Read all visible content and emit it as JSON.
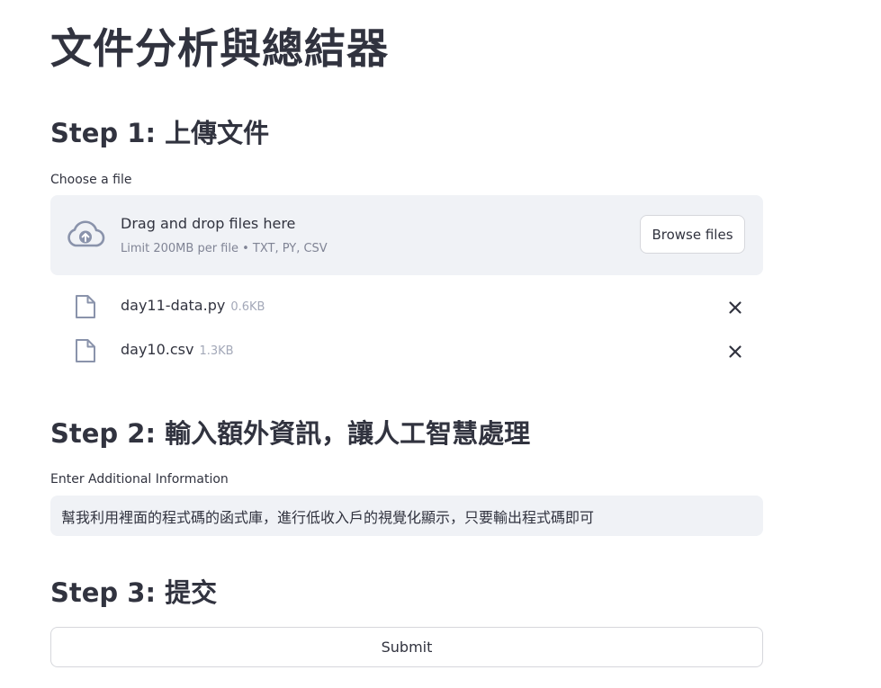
{
  "app": {
    "title": "文件分析與總結器"
  },
  "step1": {
    "heading": "Step 1: 上傳文件",
    "uploader_label": "Choose a file",
    "dropzone": {
      "icon": "cloud-upload-icon",
      "main_text": "Drag and drop files here",
      "sub_text": "Limit 200MB per file • TXT, PY, CSV",
      "browse_label": "Browse files"
    },
    "files": [
      {
        "name": "day11-data.py",
        "size": "0.6KB",
        "icon": "file-icon",
        "remove_icon": "close-icon"
      },
      {
        "name": "day10.csv",
        "size": "1.3KB",
        "icon": "file-icon",
        "remove_icon": "close-icon"
      }
    ]
  },
  "step2": {
    "heading": "Step 2: 輸入額外資訊，讓人工智慧處理",
    "input_label": "Enter Additional Information",
    "input_value": "幫我利用裡面的程式碼的函式庫，進行低收入戶的視覺化顯示，只要輸出程式碼即可"
  },
  "step3": {
    "heading": "Step 3: 提交",
    "submit_label": "Submit"
  },
  "colors": {
    "text": "#31333f",
    "muted": "#808495",
    "surface": "#f0f2f6",
    "border": "#d6d7dc",
    "icon": "#8a93ab"
  }
}
